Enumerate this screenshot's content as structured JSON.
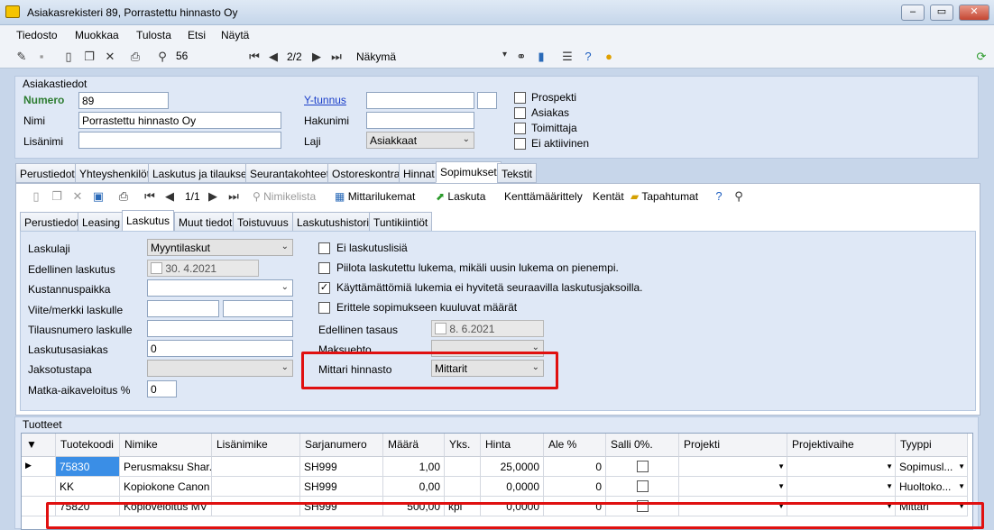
{
  "window": {
    "title": "Asiakasrekisteri 89, Porrastettu hinnasto Oy"
  },
  "menu": [
    "Tiedosto",
    "Muokkaa",
    "Tulosta",
    "Etsi",
    "Näytä"
  ],
  "toolbar": {
    "search_value": "56",
    "record_pos": "2/2",
    "view_label": "Näkymä"
  },
  "customer": {
    "section_title": "Asiakastiedot",
    "numero_label": "Numero",
    "numero": "89",
    "nimi_label": "Nimi",
    "nimi": "Porrastettu hinnasto Oy",
    "lisanimi_label": "Lisänimi",
    "ytunnus_label": "Y-tunnus",
    "hakunimi_label": "Hakunimi",
    "laji_label": "Laji",
    "laji": "Asiakkaat",
    "checks": [
      "Prospekti",
      "Asiakas",
      "Toimittaja",
      "Ei aktiivinen"
    ]
  },
  "main_tabs": [
    "Perustiedot",
    "Yhteyshenkilöt",
    "Laskutus ja tilaukset",
    "Seurantakohteet",
    "Ostoreskontra",
    "Hinnat",
    "Sopimukset",
    "Tekstit"
  ],
  "contract_toolbar": {
    "pos": "1/1",
    "nimikelista": "Nimikelista",
    "mittarilukemat": "Mittarilukemat",
    "laskuta": "Laskuta",
    "kenttamaarittely": "Kenttämäärittely",
    "kentat": "Kentät",
    "tapahtumat": "Tapahtumat"
  },
  "sub_tabs": [
    "Perustiedot",
    "Leasing",
    "Laskutus",
    "Muut tiedot",
    "Toistuvuus",
    "Laskutushistoria",
    "Tuntikiintiöt"
  ],
  "billing": {
    "laskulaji_label": "Laskulaji",
    "laskulaji": "Myyntilaskut",
    "edellinen_label": "Edellinen laskutus",
    "edellinen": "30.  4.2021",
    "kustannus_label": "Kustannuspaikka",
    "viite_label": "Viite/merkki laskulle",
    "tilausnumero_label": "Tilausnumero laskulle",
    "laskutusasiakas_label": "Laskutusasiakas",
    "laskutusasiakas": "0",
    "jaksotustapa_label": "Jaksotustapa",
    "matka_label": "Matka-aikaveloitus %",
    "matka": "0",
    "options": [
      {
        "label": "Ei laskutuslisiä",
        "checked": false
      },
      {
        "label": "Piilota laskutettu lukema, mikäli uusin lukema on pienempi.",
        "checked": false
      },
      {
        "label": "Käyttämättömiä lukemia ei hyvitetä seuraavilla laskutusjaksoilla.",
        "checked": true
      },
      {
        "label": "Erittele sopimukseen kuuluvat määrät",
        "checked": false
      }
    ],
    "tasaus_label": "Edellinen tasaus",
    "tasaus": "8.  6.2021",
    "maksuehto_label": "Maksuehto",
    "mittari_label": "Mittari hinnasto",
    "mittari": "Mittarit"
  },
  "products": {
    "title": "Tuotteet",
    "columns": [
      "Tuotekoodi",
      "Nimike",
      "Lisänimike",
      "Sarjanumero",
      "Määrä",
      "Yks.",
      "Hinta",
      "Ale %",
      "Salli 0%.",
      "Projekti",
      "Projektivaihe",
      "Tyyppi"
    ],
    "rows": [
      {
        "code": "75830",
        "name": "Perusmaksu Shar...",
        "extra": "",
        "serial": "SH999",
        "qty": "1,00",
        "unit": "",
        "price": "25,0000",
        "ale": "0",
        "type": "Sopimusl..."
      },
      {
        "code": "KK",
        "name": "Kopiokone Canon",
        "extra": "",
        "serial": "SH999",
        "qty": "0,00",
        "unit": "",
        "price": "0,0000",
        "ale": "0",
        "type": "Huoltoko..."
      },
      {
        "code": "75820",
        "name": "Kopioveloitus MV",
        "extra": "",
        "serial": "SH999",
        "qty": "500,00",
        "unit": "kpl",
        "price": "0,0000",
        "ale": "0",
        "type": "Mittari"
      }
    ]
  }
}
